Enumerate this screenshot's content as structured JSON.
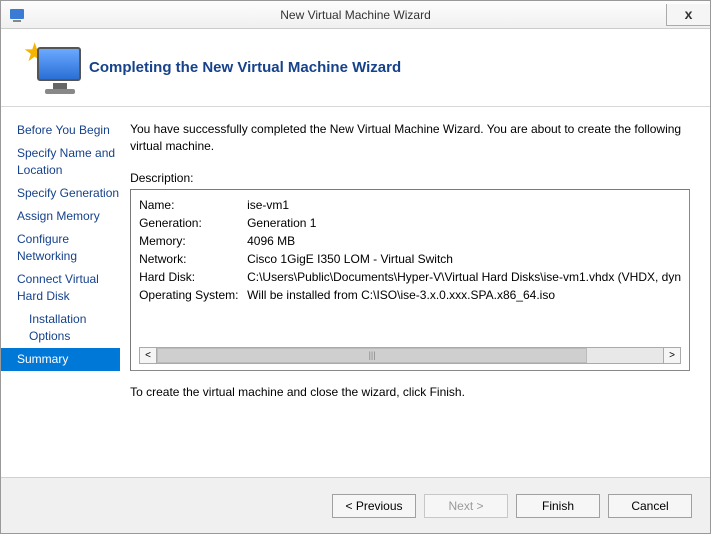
{
  "window": {
    "title": "New Virtual Machine Wizard",
    "close_symbol": "x"
  },
  "header": {
    "heading": "Completing the New Virtual Machine Wizard"
  },
  "sidebar": {
    "items": [
      {
        "label": "Before You Begin",
        "indent": false,
        "selected": false
      },
      {
        "label": "Specify Name and Location",
        "indent": false,
        "selected": false
      },
      {
        "label": "Specify Generation",
        "indent": false,
        "selected": false
      },
      {
        "label": "Assign Memory",
        "indent": false,
        "selected": false
      },
      {
        "label": "Configure Networking",
        "indent": false,
        "selected": false
      },
      {
        "label": "Connect Virtual Hard Disk",
        "indent": false,
        "selected": false
      },
      {
        "label": "Installation Options",
        "indent": true,
        "selected": false
      },
      {
        "label": "Summary",
        "indent": false,
        "selected": true
      }
    ]
  },
  "content": {
    "intro": "You have successfully completed the New Virtual Machine Wizard. You are about to create the following virtual machine.",
    "description_label": "Description:",
    "fields": [
      {
        "label": "Name:",
        "value": "ise-vm1"
      },
      {
        "label": "Generation:",
        "value": "Generation 1"
      },
      {
        "label": "Memory:",
        "value": "4096 MB"
      },
      {
        "label": "Network:",
        "value": "Cisco 1GigE I350 LOM - Virtual Switch"
      },
      {
        "label": "Hard Disk:",
        "value": "C:\\Users\\Public\\Documents\\Hyper-V\\Virtual Hard Disks\\ise-vm1.vhdx (VHDX, dyn"
      },
      {
        "label": "Operating System:",
        "value": "Will be installed from C:\\ISO\\ise-3.x.0.xxx.SPA.x86_64.iso"
      }
    ],
    "scroll_left": "<",
    "scroll_right": ">",
    "scroll_thumb": "|||",
    "post_text": "To create the virtual machine and close the wizard, click Finish."
  },
  "footer": {
    "previous": "< Previous",
    "next": "Next >",
    "finish": "Finish",
    "cancel": "Cancel"
  }
}
